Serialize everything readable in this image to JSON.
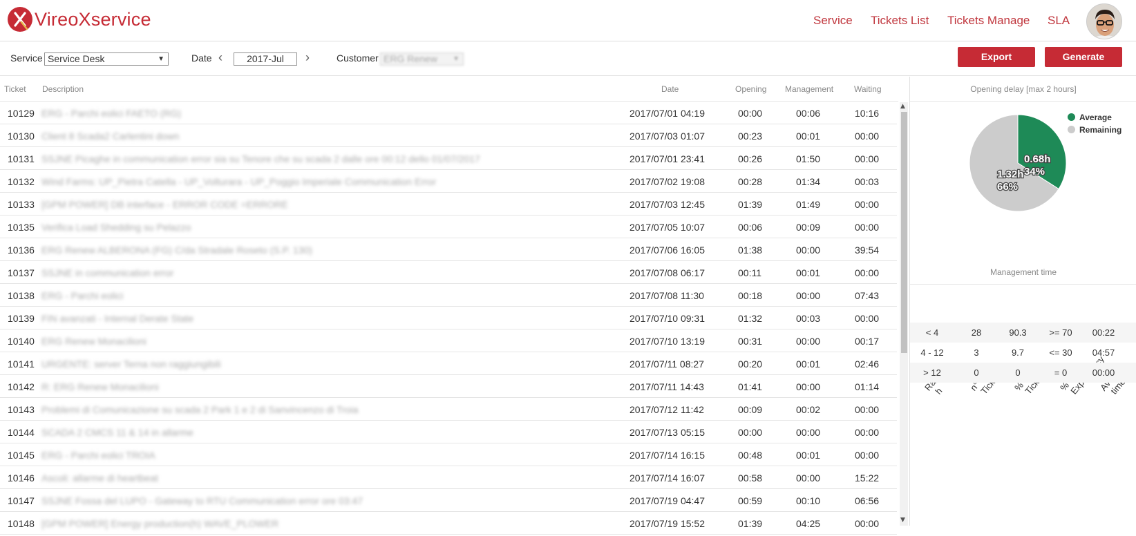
{
  "brand": {
    "name": "VireoXservice",
    "logo_letter": "X",
    "accent": "#c62b35"
  },
  "nav": [
    "Service",
    "Tickets List",
    "Tickets Manage",
    "SLA"
  ],
  "toolbar": {
    "service_label": "Service",
    "service_value": "Service Desk",
    "date_label": "Date",
    "date_value": "2017-Jul",
    "customer_label": "Customer",
    "customer_value": "ERG Renew",
    "export_label": "Export",
    "generate_label": "Generate"
  },
  "table": {
    "headers": {
      "ticket": "Ticket",
      "description": "Description",
      "date": "Date",
      "opening": "Opening",
      "management": "Management",
      "waiting": "Waiting"
    },
    "rows": [
      {
        "ticket": "10129",
        "description": "ERG - Parchi eolici FAETO (RG)",
        "date": "2017/07/01 04:19",
        "opening": "00:00",
        "management": "00:06",
        "waiting": "10:16"
      },
      {
        "ticket": "10130",
        "description": "Client 8 Scada2 Carlentini down",
        "date": "2017/07/03 01:07",
        "opening": "00:23",
        "management": "00:01",
        "waiting": "00:00"
      },
      {
        "ticket": "10131",
        "description": "SSJNE Picaghe in communication error sia su Tenore che su scada 2 dalle ore 00:12 dello 01/07/2017",
        "date": "2017/07/01 23:41",
        "opening": "00:26",
        "management": "01:50",
        "waiting": "00:00"
      },
      {
        "ticket": "10132",
        "description": "Wind Farms: UP_Pietra Catella - UP_Volturara - UP_Poggio Imperiale Communication Error",
        "date": "2017/07/02 19:08",
        "opening": "00:28",
        "management": "01:34",
        "waiting": "00:03"
      },
      {
        "ticket": "10133",
        "description": "[GPM POWER] DB interface - ERROR CODE =ERRORE",
        "date": "2017/07/03 12:45",
        "opening": "01:39",
        "management": "01:49",
        "waiting": "00:00"
      },
      {
        "ticket": "10135",
        "description": "Verifica Load Shedding su Pelazzo",
        "date": "2017/07/05 10:07",
        "opening": "00:06",
        "management": "00:09",
        "waiting": "00:00"
      },
      {
        "ticket": "10136",
        "description": "ERG Renew ALBERONA (FG) C/da Stradale Roseto (S.P. 130)",
        "date": "2017/07/06 16:05",
        "opening": "01:38",
        "management": "00:00",
        "waiting": "39:54"
      },
      {
        "ticket": "10137",
        "description": "SSJNE in communication error",
        "date": "2017/07/08 06:17",
        "opening": "00:11",
        "management": "00:01",
        "waiting": "00:00"
      },
      {
        "ticket": "10138",
        "description": "ERG - Parchi eolici",
        "date": "2017/07/08 11:30",
        "opening": "00:18",
        "management": "00:00",
        "waiting": "07:43"
      },
      {
        "ticket": "10139",
        "description": "FIN avanzati - Internal Derate State",
        "date": "2017/07/10 09:31",
        "opening": "01:32",
        "management": "00:03",
        "waiting": "00:00"
      },
      {
        "ticket": "10140",
        "description": "ERG Renew Monacilioni",
        "date": "2017/07/10 13:19",
        "opening": "00:31",
        "management": "00:00",
        "waiting": "00:17"
      },
      {
        "ticket": "10141",
        "description": "URGENTE: server Terna non raggiungibili",
        "date": "2017/07/11 08:27",
        "opening": "00:20",
        "management": "00:01",
        "waiting": "02:46"
      },
      {
        "ticket": "10142",
        "description": "R: ERG Renew Monacilioni",
        "date": "2017/07/11 14:43",
        "opening": "01:41",
        "management": "00:00",
        "waiting": "01:14"
      },
      {
        "ticket": "10143",
        "description": "Problemi di Comunicazione su scada 2 Park 1 e 2 di Sanvincenzo di Troia",
        "date": "2017/07/12 11:42",
        "opening": "00:09",
        "management": "00:02",
        "waiting": "00:00"
      },
      {
        "ticket": "10144",
        "description": "SCADA 2 CMCS 11 & 14 in allarme",
        "date": "2017/07/13 05:15",
        "opening": "00:00",
        "management": "00:00",
        "waiting": "00:00"
      },
      {
        "ticket": "10145",
        "description": "ERG - Parchi eolici TROIA",
        "date": "2017/07/14 16:15",
        "opening": "00:48",
        "management": "00:01",
        "waiting": "00:00"
      },
      {
        "ticket": "10146",
        "description": "Ascoli: allarme di heartbeat",
        "date": "2017/07/14 16:07",
        "opening": "00:58",
        "management": "00:00",
        "waiting": "15:22"
      },
      {
        "ticket": "10147",
        "description": "SSJNE Fossa del LUPO - Gateway to RTU Communication error ore 03:47",
        "date": "2017/07/19 04:47",
        "opening": "00:59",
        "management": "00:10",
        "waiting": "06:56"
      },
      {
        "ticket": "10148",
        "description": "[GPM POWER] Energy production(h) WAVE_PLOWER",
        "date": "2017/07/19 15:52",
        "opening": "01:39",
        "management": "04:25",
        "waiting": "00:00"
      }
    ]
  },
  "opening_delay": {
    "title": "Opening delay [max 2 hours]",
    "legend": [
      {
        "label": "Average",
        "color": "#1e8a57"
      },
      {
        "label": "Remaining",
        "color": "#cccccc"
      }
    ],
    "average_value": "0.68h",
    "average_pct": "34%",
    "remaining_value": "1.32h",
    "remaining_pct": "66%"
  },
  "chart_data": {
    "type": "pie",
    "title": "Opening delay [max 2 hours]",
    "categories": [
      "Average",
      "Remaining"
    ],
    "values": [
      0.68,
      1.32
    ],
    "percent": [
      34,
      66
    ],
    "colors": [
      "#1e8a57",
      "#cccccc"
    ]
  },
  "management_time": {
    "title": "Management time",
    "headers": [
      "Range\nh",
      "n°\nTickets",
      "%\nTickets",
      "%\nExpectancy",
      "Average\ntime"
    ],
    "rows": [
      {
        "range": "< 4",
        "tickets": "28",
        "pct_tickets": "90.3",
        "expectancy": ">= 70",
        "avg": "00:22"
      },
      {
        "range": "4 - 12",
        "tickets": "3",
        "pct_tickets": "9.7",
        "expectancy": "<= 30",
        "avg": "04:57"
      },
      {
        "range": "> 12",
        "tickets": "0",
        "pct_tickets": "0",
        "expectancy": "= 0",
        "avg": "00:00"
      }
    ]
  }
}
